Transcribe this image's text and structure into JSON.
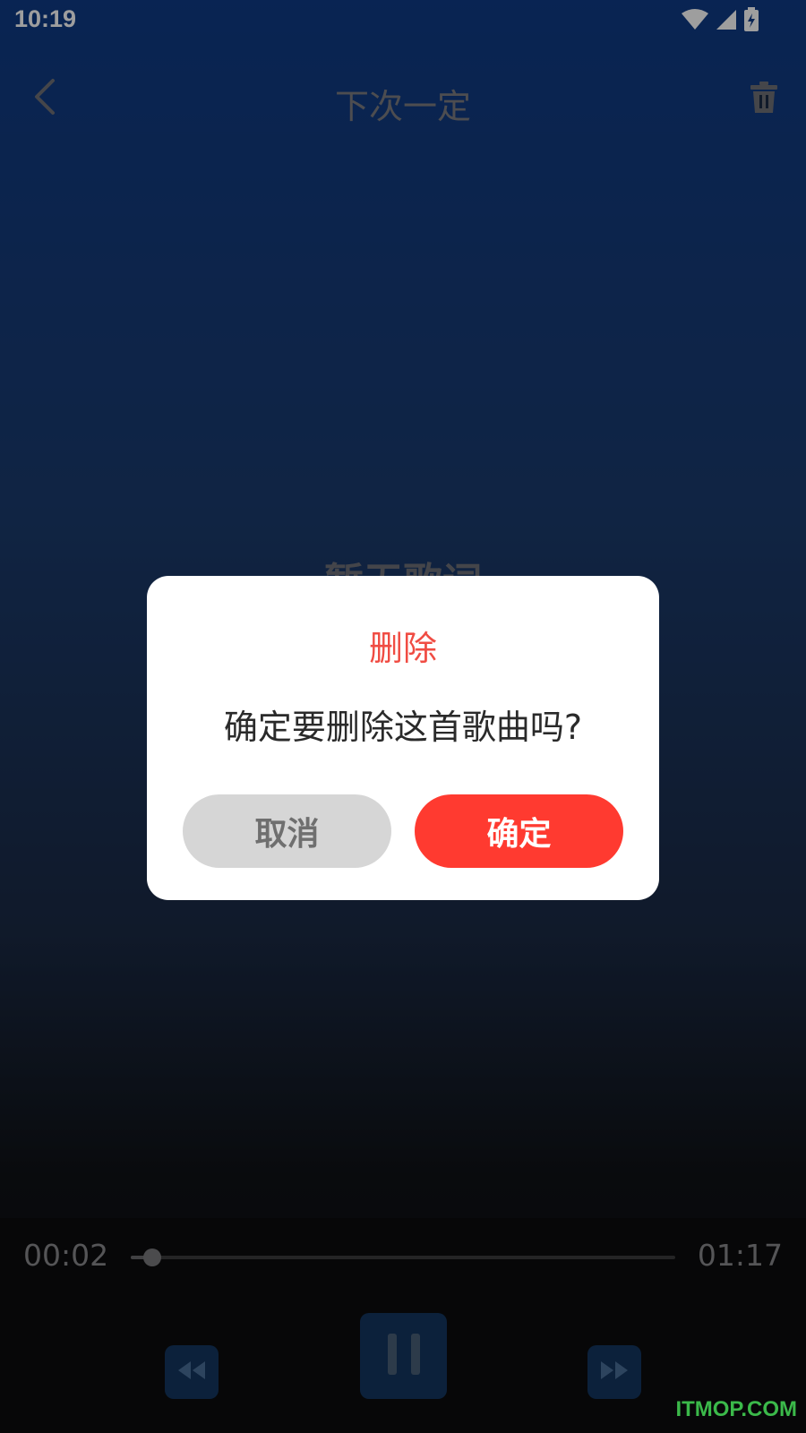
{
  "status_bar": {
    "time": "10:19",
    "icons": [
      "wifi-icon",
      "cell-signal-icon",
      "battery-charging-icon"
    ]
  },
  "header": {
    "title": "下次一定",
    "back_icon": "chevron-left-icon",
    "delete_icon": "trash-icon"
  },
  "lyrics": {
    "placeholder": "暂无歌词"
  },
  "dialog": {
    "title": "删除",
    "message": "确定要删除这首歌曲吗?",
    "cancel_label": "取消",
    "confirm_label": "确定"
  },
  "player": {
    "current_time": "00:02",
    "total_time": "01:17",
    "progress": 0.04,
    "prev_icon": "rewind-icon",
    "play_icon": "pause-icon",
    "next_icon": "fast-forward-icon"
  },
  "watermark": "ITMOP.COM",
  "colors": {
    "accent": "#ff3a30",
    "dialog_title": "#f04c43",
    "control_bg": "#14365f",
    "watermark": "#3bb94a"
  }
}
